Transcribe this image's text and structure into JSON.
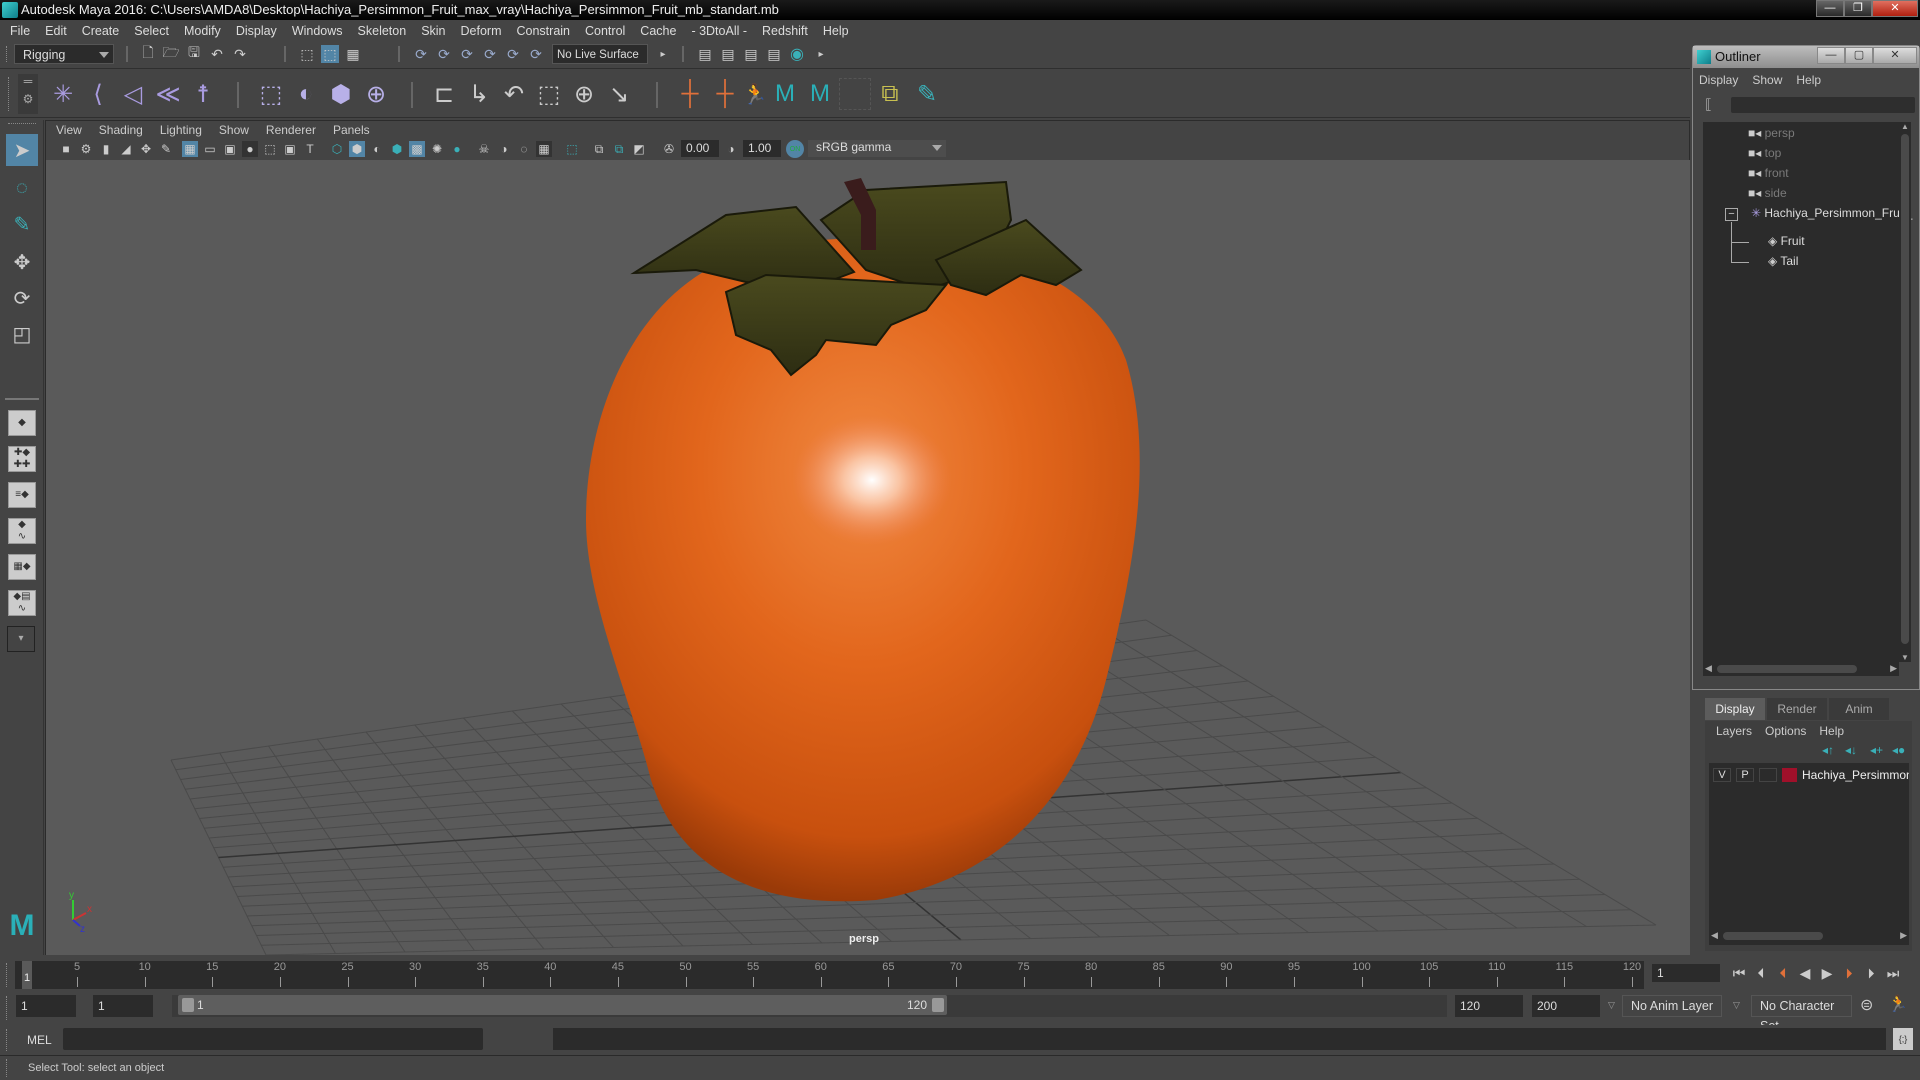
{
  "window": {
    "title": "Autodesk Maya 2016: C:\\Users\\AMDA8\\Desktop\\Hachiya_Persimmon_Fruit_max_vray\\Hachiya_Persimmon_Fruit_mb_standart.mb",
    "minimize": "—",
    "maximize": "❐",
    "close": "✕"
  },
  "menubar": [
    "File",
    "Edit",
    "Create",
    "Select",
    "Modify",
    "Display",
    "Windows",
    "Skeleton",
    "Skin",
    "Deform",
    "Constrain",
    "Control",
    "Cache",
    "- 3DtoAll -",
    "Redshift",
    "Help"
  ],
  "statusline": {
    "menuset": "Rigging",
    "live_surface": "No Live Surface"
  },
  "shelf": {
    "icons": [
      "joint-tool-icon",
      "ik-handle-icon",
      "ik-spline-icon",
      "bind-skin-icon",
      "humanik-icon",
      "paint-weights-icon",
      "smooth-bind-icon",
      "lattice-icon",
      "cluster-icon",
      "parent-constraint-icon",
      "point-constraint-icon",
      "orient-constraint-icon",
      "scale-constraint-icon",
      "aim-constraint-icon",
      "pole-vector-icon",
      "add-joint-icon",
      "connect-joint-icon",
      "character-icon",
      "maya-logo-icon",
      "maya-logo-icon-2",
      "empty-slot-icon",
      "layers-hide-icon",
      "paint-select-icon"
    ]
  },
  "viewport": {
    "panel_menu": [
      "View",
      "Shading",
      "Lighting",
      "Show",
      "Renderer",
      "Panels"
    ],
    "exposure": "0.00",
    "gamma": "1.00",
    "color_management": "sRGB gamma",
    "camera_label": "persp",
    "axis": {
      "x": "x",
      "y": "y",
      "z": "z"
    }
  },
  "outliner": {
    "title": "Outliner",
    "menu": [
      "Display",
      "Show",
      "Help"
    ],
    "items": [
      {
        "label": "persp",
        "type": "camera"
      },
      {
        "label": "top",
        "type": "camera"
      },
      {
        "label": "front",
        "type": "camera"
      },
      {
        "label": "side",
        "type": "camera"
      },
      {
        "label": "Hachiya_Persimmon_Fruit_",
        "type": "group",
        "expanded": "−"
      },
      {
        "label": "Fruit",
        "type": "mesh"
      },
      {
        "label": "Tail",
        "type": "mesh"
      }
    ]
  },
  "layer_editor": {
    "tabs": [
      "Display",
      "Render",
      "Anim"
    ],
    "active_tab": "Display",
    "menu": [
      "Layers",
      "Options",
      "Help"
    ],
    "layers": [
      {
        "visible": "V",
        "playback": "P",
        "color": "#a0102a",
        "name": "Hachiya_Persimmon_Fr"
      }
    ]
  },
  "timeline": {
    "ticks": [
      5,
      10,
      15,
      20,
      25,
      30,
      35,
      40,
      45,
      50,
      55,
      60,
      65,
      70,
      75,
      80,
      85,
      90,
      95,
      100,
      105,
      110,
      115,
      120
    ],
    "start": 1,
    "end": 120,
    "current_frame": "1",
    "current_frame_field": "1"
  },
  "range": {
    "start_field": "1",
    "anim_start_field": "1",
    "range_start_label": "1",
    "range_end_label": "120",
    "end_field": "120",
    "anim_end_field": "200",
    "anim_layer": "No Anim Layer",
    "character_set": "No Character Set"
  },
  "cmdline": {
    "label": "MEL",
    "value": ""
  },
  "helpline": {
    "text": "Select Tool: select an object"
  },
  "colors": {
    "accent": "#5285a6",
    "teal": "#3ab0b8",
    "persimmon": "#e0661a",
    "layer_color": "#a0102a"
  }
}
